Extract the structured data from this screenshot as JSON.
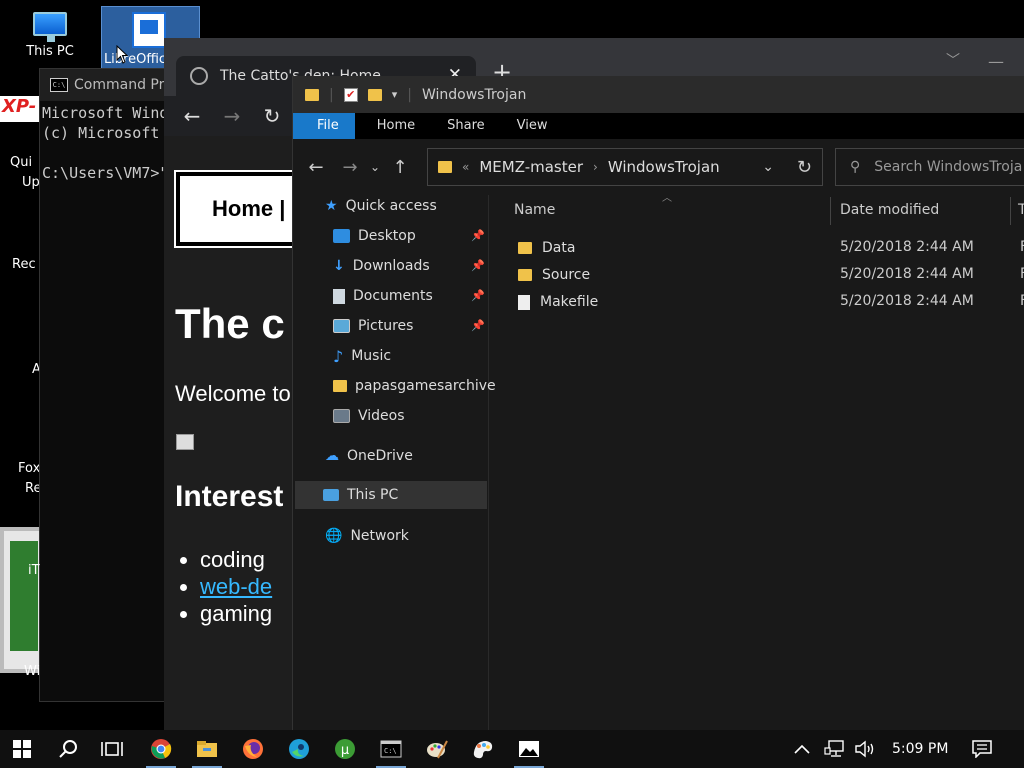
{
  "desktop": {
    "this_pc_label": "This PC",
    "libreoffice_label": "LibreOffic",
    "xp_badge": "XP-",
    "side_labels": [
      "Qui",
      "Up",
      "Rec",
      "A",
      "Fox",
      "Re",
      "iT",
      "Wi"
    ]
  },
  "cmd": {
    "title": "Command Pro",
    "lines": [
      "Microsoft Wind",
      "(c) Microsoft",
      "",
      "C:\\Users\\VM7>\""
    ]
  },
  "browser": {
    "tab_title": "The Catto's den: Home",
    "close_glyph": "✕",
    "new_tab_glyph": "+",
    "page": {
      "nav_label": "Home |",
      "heading": "The c",
      "welcome": "Welcome to",
      "subheading": "Interest",
      "list": [
        "coding",
        "web-de",
        "gaming"
      ]
    }
  },
  "explorer": {
    "qat_title": "WindowsTrojan",
    "ribbon": [
      "File",
      "Home",
      "Share",
      "View"
    ],
    "breadcrumb": [
      "MEMZ-master",
      "WindowsTrojan"
    ],
    "search_placeholder": "Search WindowsTroja",
    "nav": {
      "quick_access": "Quick access",
      "desktop": "Desktop",
      "downloads": "Downloads",
      "documents": "Documents",
      "pictures": "Pictures",
      "music": "Music",
      "papas": "papasgamesarchive",
      "videos": "Videos",
      "onedrive": "OneDrive",
      "this_pc": "This PC",
      "network": "Network"
    },
    "columns": {
      "name": "Name",
      "date": "Date modified",
      "type": "T"
    },
    "files": [
      {
        "name": "Data",
        "date": "5/20/2018 2:44 AM",
        "type": "F",
        "kind": "folder"
      },
      {
        "name": "Source",
        "date": "5/20/2018 2:44 AM",
        "type": "F",
        "kind": "folder"
      },
      {
        "name": "Makefile",
        "date": "5/20/2018 2:44 AM",
        "type": "F",
        "kind": "file"
      }
    ]
  },
  "taskbar": {
    "clock": "5:09 PM",
    "apps": [
      "chrome-icon",
      "file-explorer-icon",
      "firefox-icon",
      "edge-icon",
      "utorrent-icon",
      "cmd-icon",
      "paint-icon",
      "paint3d-icon",
      "photos-icon"
    ]
  },
  "colors": {
    "accent": "#1979ca",
    "folder": "#f0c24a",
    "link": "#36b9ff"
  }
}
